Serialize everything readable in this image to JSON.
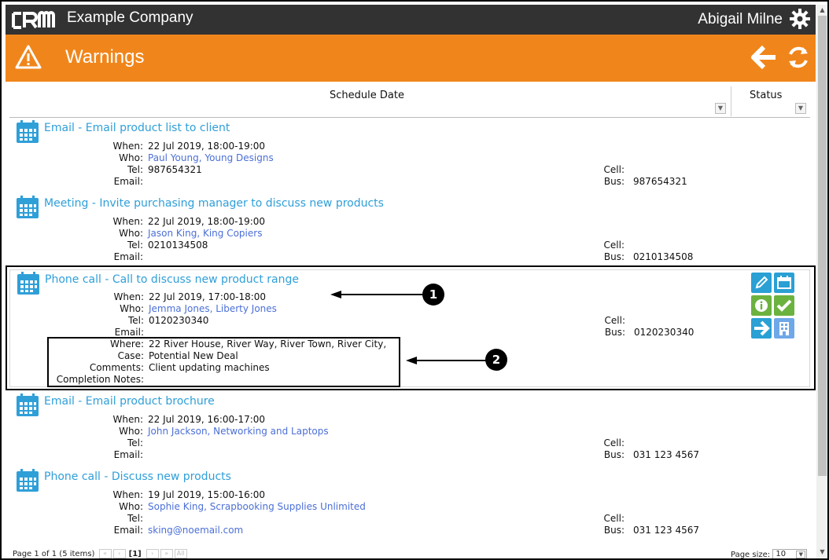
{
  "app": {
    "company": "Example Company",
    "user": "Abigail Milne",
    "logo_text": "CRM"
  },
  "page": {
    "title": "Warnings"
  },
  "columns": {
    "schedule_date": "Schedule Date",
    "status": "Status"
  },
  "labels": {
    "when": "When:",
    "who": "Who:",
    "tel": "Tel:",
    "email": "Email:",
    "cell": "Cell:",
    "bus": "Bus:",
    "where": "Where:",
    "case": "Case:",
    "comments": "Comments:",
    "completion_notes": "Completion Notes:"
  },
  "activities": [
    {
      "title": "Email - Email product list to client",
      "when": "22 Jul 2019, 18:00-19:00",
      "who": "Paul Young, Young Designs",
      "tel": "987654321",
      "email": "",
      "cell": "",
      "bus": "987654321"
    },
    {
      "title": "Meeting - Invite purchasing manager to discuss new products",
      "when": "22 Jul 2019, 18:00-19:00",
      "who": "Jason King, King Copiers",
      "tel": "0210134508",
      "email": "",
      "cell": "",
      "bus": "0210134508"
    },
    {
      "title": "Phone call - Call to discuss new product range",
      "when": "22 Jul 2019, 17:00-18:00",
      "who": "Jemma Jones, Liberty Jones",
      "tel": "0120230340",
      "email": "",
      "cell": "",
      "bus": "0120230340",
      "where": "22 River House, River Way, River Town, River City,",
      "case": "Potential New Deal",
      "comments": "Client updating machines",
      "completion_notes": ""
    },
    {
      "title": "Email - Email product brochure",
      "when": "22 Jul 2019, 16:00-17:00",
      "who": "John Jackson, Networking and Laptops",
      "tel": "",
      "email": "",
      "cell": "",
      "bus": "031 123 4567"
    },
    {
      "title": "Phone call - Discuss new products",
      "when": "19 Jul 2019, 15:00-16:00",
      "who": "Sophie King, Scrapbooking Supplies Unlimited",
      "tel": "",
      "email": "sking@noemail.com",
      "cell": "",
      "bus": "031 123 4567"
    }
  ],
  "callouts": {
    "marker1": "1",
    "marker2": "2"
  },
  "pager": {
    "summary": "Page 1 of 1 (5 items)",
    "current": "[1]",
    "first": "«",
    "prev": "‹",
    "next": "›",
    "last": "»",
    "all": "All",
    "page_size_label": "Page size:",
    "page_size": "10"
  },
  "colors": {
    "topbar": "#323232",
    "header": "#f0861b",
    "link": "#2f9fd8",
    "contact": "#4b6fd6",
    "action_teal": "#2aa0d4",
    "action_green": "#6cb23f",
    "action_building": "#6fa8e8"
  },
  "icons": [
    "crm-logo-icon",
    "gear-icon",
    "warning-icon",
    "back-arrow-icon",
    "refresh-icon",
    "calendar-icon",
    "edit-icon",
    "info-icon",
    "complete-check-icon",
    "forward-arrow-icon",
    "building-icon",
    "dropdown-arrow-icon"
  ]
}
